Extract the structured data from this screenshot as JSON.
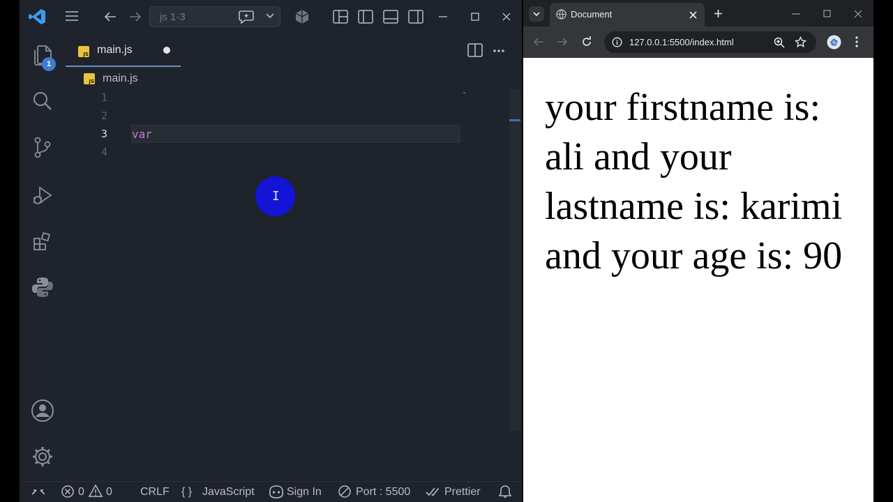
{
  "vscode": {
    "search_text": "js 1-3",
    "explorer_badge": "1",
    "tab": {
      "label": "main.js"
    },
    "breadcrumb": {
      "file": "main.js"
    },
    "line_numbers": [
      "1",
      "2",
      "3",
      "4"
    ],
    "code": {
      "line3": "var"
    },
    "cursor_glyph": "I",
    "status": {
      "errors": "0",
      "warnings": "0",
      "eol": "CRLF",
      "language_braces": "{ }",
      "language": "JavaScript",
      "sign_in": "Sign In",
      "port": "Port : 5500",
      "formatter": "Prettier"
    }
  },
  "chrome": {
    "tab_title": "Document",
    "url": "127.0.0.1:5500/index.html",
    "page_text": "your firstname is: ali and your lastname is: karimi and your age is: 90"
  },
  "colors": {
    "editor_bg": "#1f232b",
    "keyword": "#c678dd",
    "cursor_highlight": "#1414d6",
    "badge_blue": "#3d7bd6",
    "js_yellow": "#e8c43a"
  }
}
